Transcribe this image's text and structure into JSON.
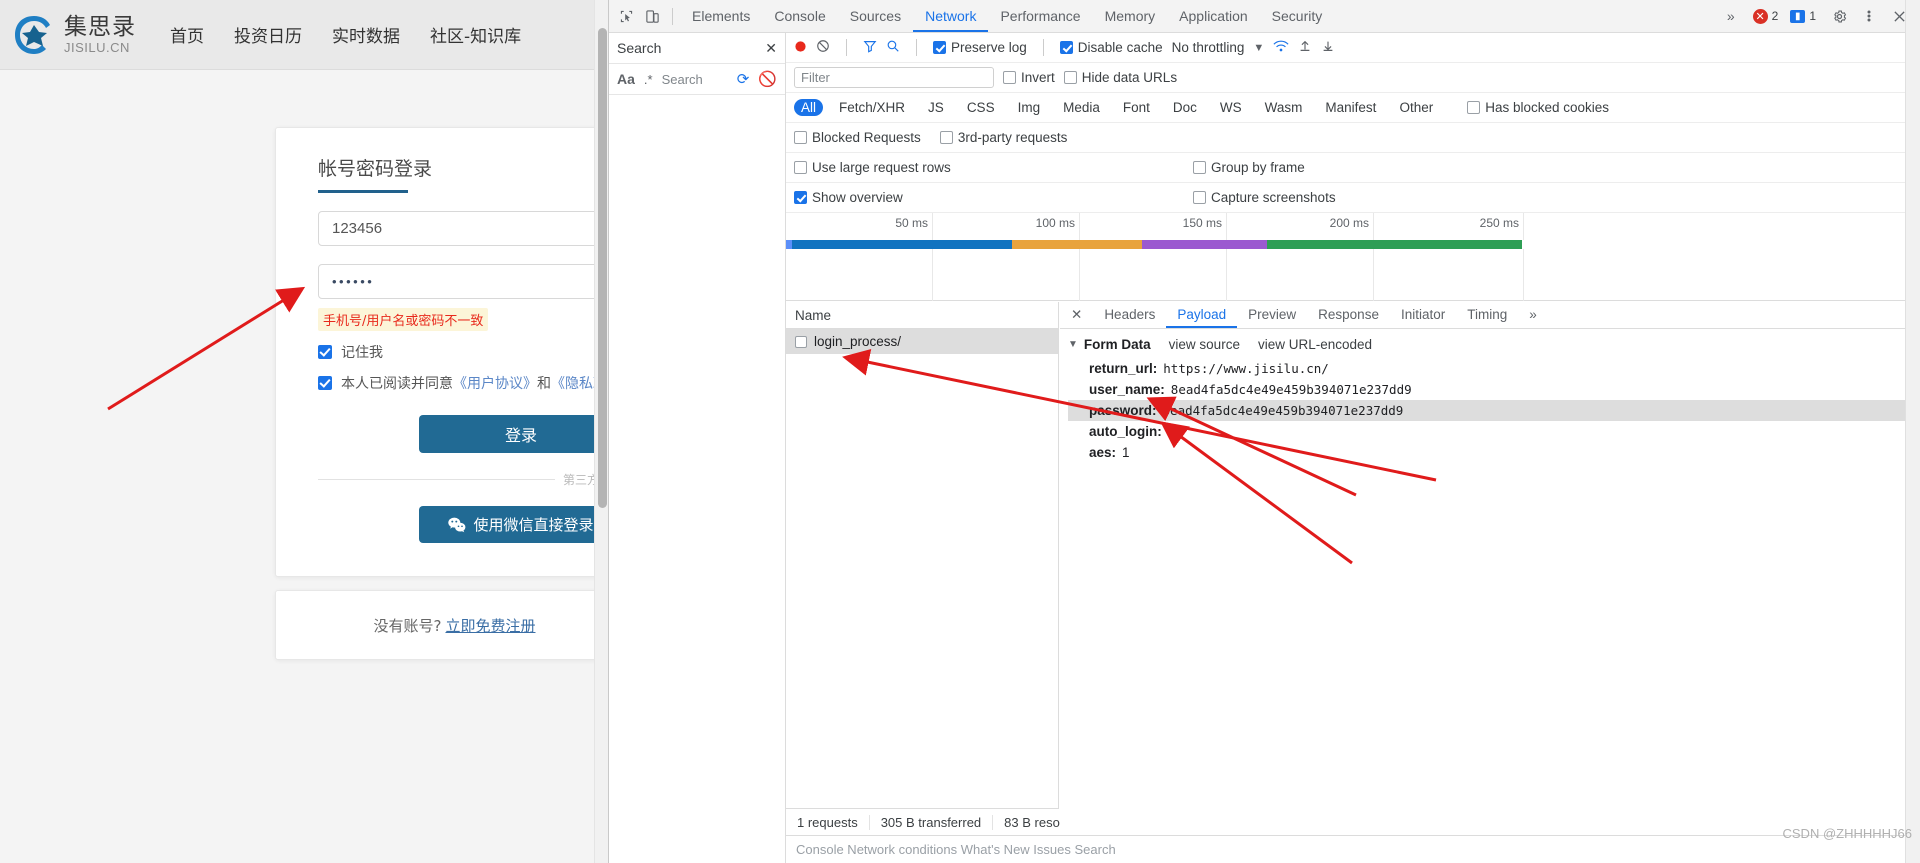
{
  "site": {
    "logo_cn": "集思录",
    "logo_en": "JISILU.CN",
    "nav": [
      "首页",
      "投资日历",
      "实时数据",
      "社区-知识库"
    ]
  },
  "login": {
    "tab_title": "帐号密码登录",
    "username_value": "123456",
    "password_value": "••••••",
    "error_message": "手机号/用户名或密码不一致",
    "remember_label": "记住我",
    "agree_prefix": "本人已阅读并同意",
    "agree_link1": "《用户协议》",
    "agree_and": "和",
    "agree_link2": "《隐私政策》",
    "login_button": "登录",
    "divider_text": "第三方登录",
    "wechat_button": "使用微信直接登录",
    "no_account_text": "没有账号?",
    "register_link": "立即免费注册"
  },
  "devtools": {
    "tabs": [
      "Elements",
      "Console",
      "Sources",
      "Network",
      "Performance",
      "Memory",
      "Application",
      "Security"
    ],
    "active_tab": "Network",
    "more_tabs": "»",
    "error_count": "2",
    "warning_count": "1",
    "search": {
      "title": "Search",
      "close": "✕",
      "match_case": "Aa",
      "regex": ".*",
      "placeholder": "Search"
    },
    "toolbar": {
      "preserve_log": "Preserve log",
      "disable_cache": "Disable cache",
      "throttling": "No throttling",
      "filter_placeholder": "Filter",
      "invert": "Invert",
      "hide_data_urls": "Hide data URLs",
      "types": [
        "All",
        "Fetch/XHR",
        "JS",
        "CSS",
        "Img",
        "Media",
        "Font",
        "Doc",
        "WS",
        "Wasm",
        "Manifest",
        "Other"
      ],
      "active_type": "All",
      "has_blocked_cookies": "Has blocked cookies",
      "blocked_requests": "Blocked Requests",
      "third_party_requests": "3rd-party requests",
      "use_large_request_rows": "Use large request rows",
      "group_by_frame": "Group by frame",
      "show_overview": "Show overview",
      "capture_screenshots": "Capture screenshots"
    },
    "overview_ticks": [
      "50 ms",
      "100 ms",
      "150 ms",
      "200 ms",
      "250 ms"
    ],
    "requests": {
      "column_name": "Name",
      "rows": [
        {
          "name": "login_process/"
        }
      ],
      "footer": [
        "1 requests",
        "305 B transferred",
        "83 B reso"
      ]
    },
    "detail": {
      "tabs": [
        "Headers",
        "Payload",
        "Preview",
        "Response",
        "Initiator",
        "Timing"
      ],
      "active_tab": "Payload",
      "more": "»",
      "close": "✕",
      "form_data_title": "Form Data",
      "view_source": "view source",
      "view_url_encoded": "view URL-encoded",
      "fields": [
        {
          "key": "return_url:",
          "value": "https://www.jisilu.cn/",
          "mono": true,
          "selected": false
        },
        {
          "key": "user_name:",
          "value": "8ead4fa5dc4e49e459b394071e237dd9",
          "mono": true,
          "selected": false
        },
        {
          "key": "password:",
          "value": "8ead4fa5dc4e49e459b394071e237dd9",
          "mono": true,
          "selected": true
        },
        {
          "key": "auto_login:",
          "value": "1",
          "mono": false,
          "selected": false
        },
        {
          "key": "aes:",
          "value": "1",
          "mono": false,
          "selected": false
        }
      ]
    },
    "drawer_hint": "Console   Network conditions   What's New   Issues   Search"
  },
  "watermark": "CSDN @ZHHHHHJ66",
  "colors": {
    "accent": "#1a73e8",
    "button": "#216a94",
    "error_text": "#e8291c",
    "error_bg": "#fcf5d8",
    "arrow": "#e01b1b"
  }
}
